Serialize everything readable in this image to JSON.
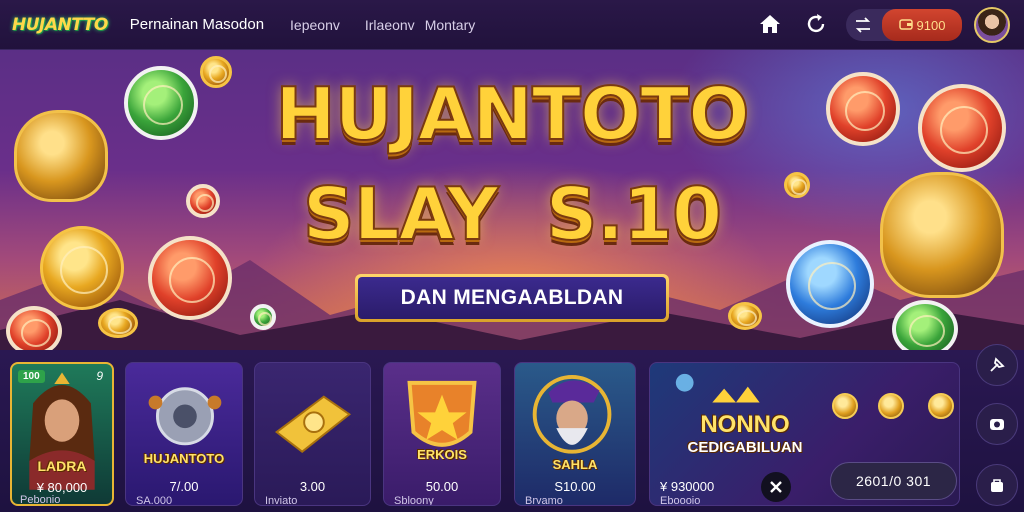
{
  "brand": {
    "logo": "HUJANTTO"
  },
  "nav": {
    "main": "Pernainan Masodon",
    "links": [
      "Iepeonv",
      "Irlaeonv",
      "Montary"
    ]
  },
  "header_icons": {
    "home": "home-icon",
    "refresh": "refresh-icon",
    "swap": "swap-icon",
    "wallet": "wallet-icon"
  },
  "wallet": {
    "balance": "9100"
  },
  "hero": {
    "line1": "HUJANTOTO",
    "line2": "SLAY  S.10",
    "subtitle": "DAN MENGAABLDAN"
  },
  "games": [
    {
      "name": "LADRA",
      "price": "¥ 80,000",
      "meta": "Pebonio",
      "badge": "100",
      "badge_num": "9"
    },
    {
      "name": "HUJANTOTO",
      "price": "7/.00",
      "meta": "SA.000"
    },
    {
      "name": "",
      "price": "3.00",
      "meta": "Inviato"
    },
    {
      "name": "ERKOIS",
      "price": "50.00",
      "meta": "Sbloony"
    },
    {
      "name": "SAHLA",
      "price": "S10.00",
      "meta": "Brvamo"
    },
    {
      "name": "NONNO",
      "subname": "CEDIGABILUAN",
      "price": "¥ 930000",
      "meta": "Eboooio"
    }
  ],
  "counter": "2601/0 301",
  "side_icons": [
    "pin-icon",
    "camera-icon",
    "bag-icon"
  ],
  "colors": {
    "accent_gold": "#ffd23a",
    "wallet_red": "#c83a26",
    "bg_purple": "#21123c"
  }
}
